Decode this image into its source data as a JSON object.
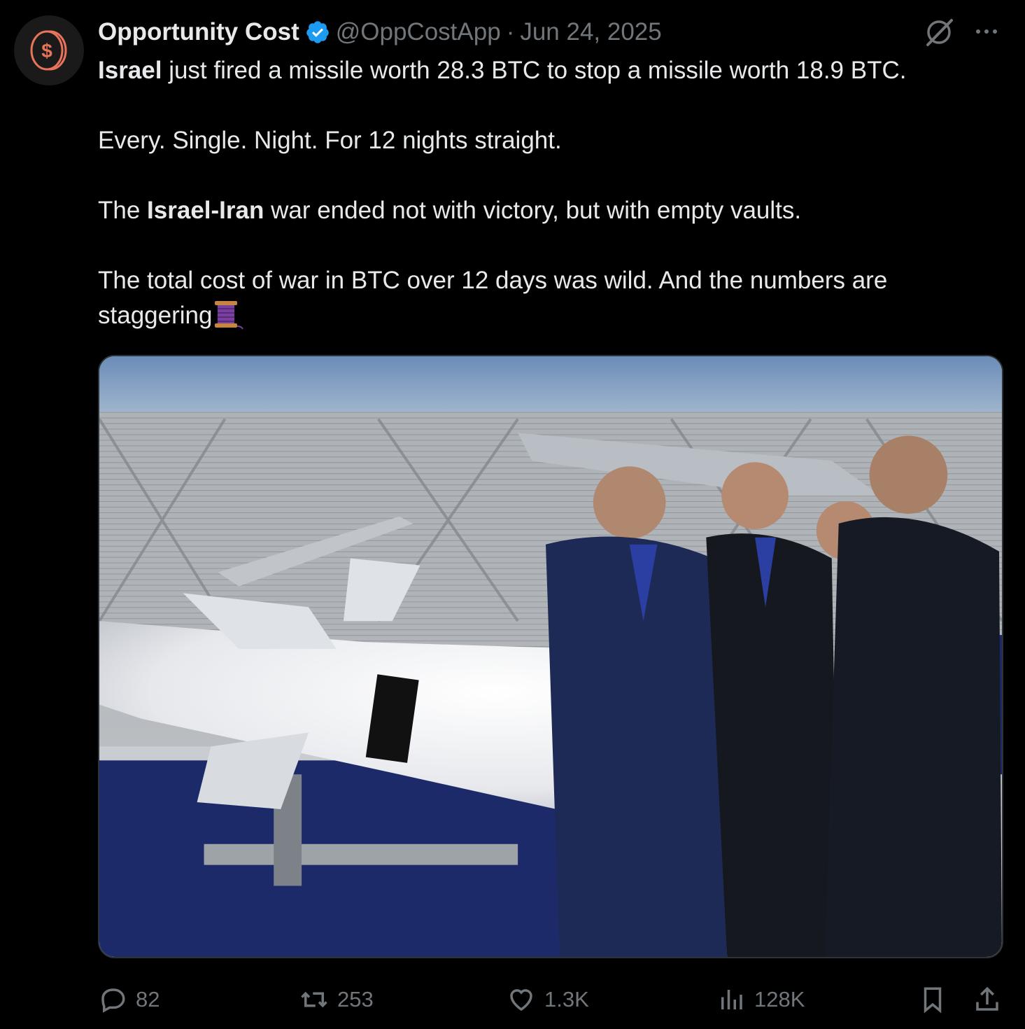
{
  "author": {
    "display_name": "Opportunity Cost",
    "handle": "@OppCostApp",
    "separator": "·",
    "date": "Jun 24, 2025",
    "avatar_icon": "coin-dollar-icon",
    "verified_icon": "verified-badge-icon"
  },
  "header_icons": [
    "grok-icon",
    "more-options-icon"
  ],
  "tweet": {
    "line1_bold": "Israel",
    "line1_rest": " just fired a missile worth 28.3 BTC to stop a missile worth 18.9 BTC.",
    "line2": "Every. Single. Night. For 12 nights straight.",
    "line3_pre": "The ",
    "line3_bold": "Israel-Iran",
    "line3_post": " war ended not with victory, but with empty vaults.",
    "line4": "The total cost of war in BTC over 12 days was wild. And the numbers are staggering",
    "emoji": "thread-spool-emoji"
  },
  "media": {
    "type": "photo",
    "icon": "photo-missile-hangar"
  },
  "actions": {
    "replies": "82",
    "reposts": "253",
    "likes": "1.3K",
    "views": "128K"
  },
  "colors": {
    "background": "#000000",
    "text": "#e7e9ea",
    "muted": "#71767b",
    "verified": "#1d9bf0",
    "accent_coin": "#e8745a"
  }
}
